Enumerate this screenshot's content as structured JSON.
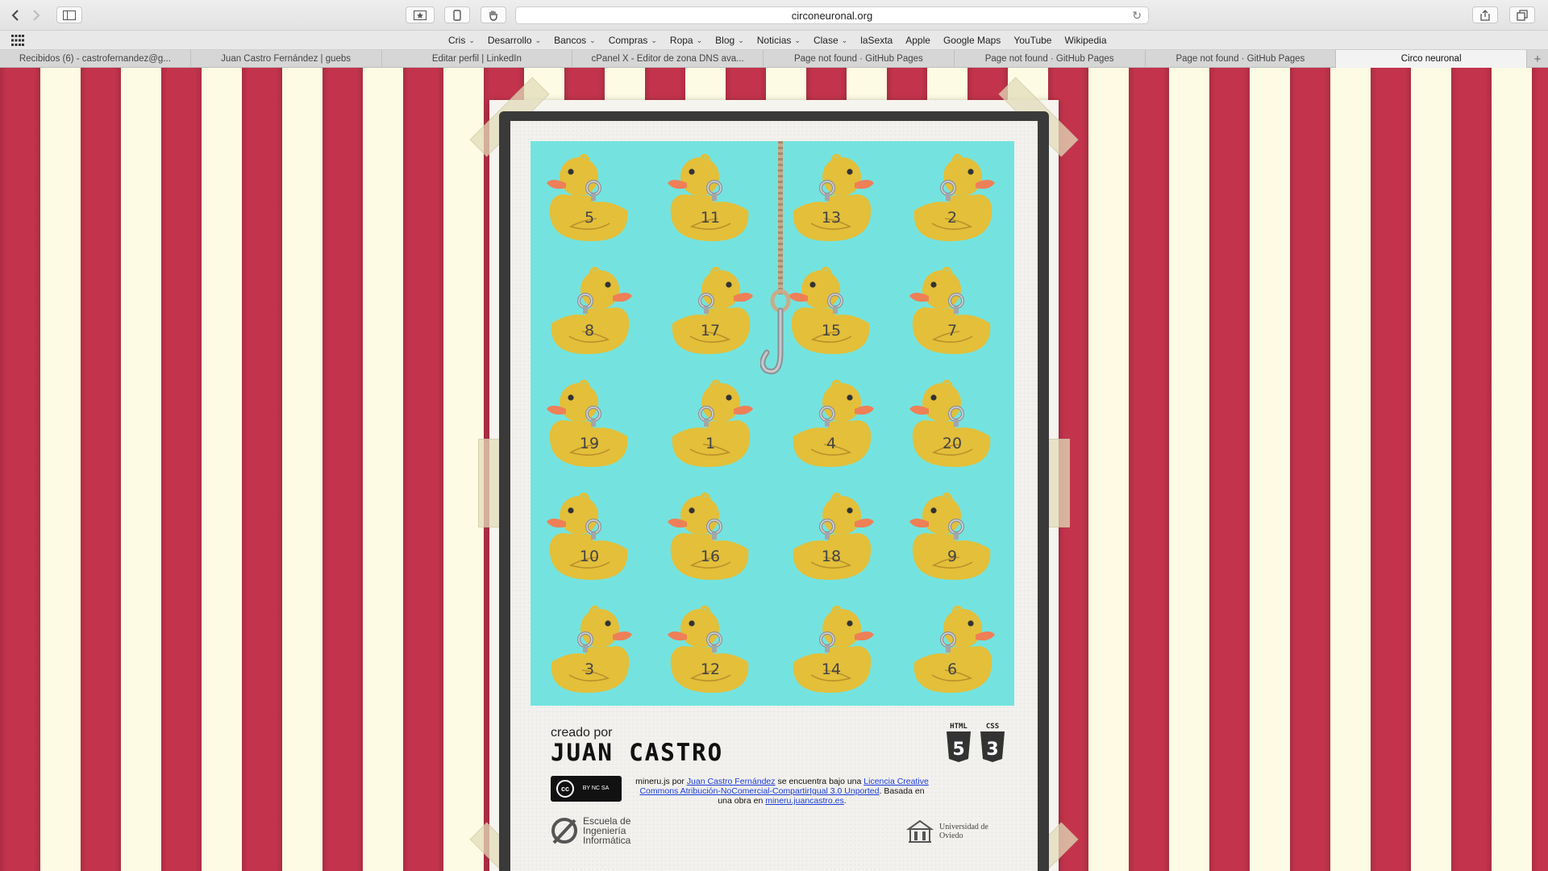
{
  "browser": {
    "url": "circoneuronal.org",
    "favorites": [
      {
        "label": "Cris",
        "menu": true
      },
      {
        "label": "Desarrollo",
        "menu": true
      },
      {
        "label": "Bancos",
        "menu": true
      },
      {
        "label": "Compras",
        "menu": true
      },
      {
        "label": "Ropa",
        "menu": true
      },
      {
        "label": "Blog",
        "menu": true
      },
      {
        "label": "Noticias",
        "menu": true
      },
      {
        "label": "Clase",
        "menu": true
      },
      {
        "label": "laSexta",
        "menu": false
      },
      {
        "label": "Apple",
        "menu": false
      },
      {
        "label": "Google Maps",
        "menu": false
      },
      {
        "label": "YouTube",
        "menu": false
      },
      {
        "label": "Wikipedia",
        "menu": false
      }
    ],
    "tabs": [
      {
        "label": "Recibidos (6) - castrofernandez@g...",
        "active": false
      },
      {
        "label": "Juan Castro Fernández | guebs",
        "active": false
      },
      {
        "label": "Editar perfil | LinkedIn",
        "active": false
      },
      {
        "label": "cPanel X - Editor de zona DNS ava...",
        "active": false
      },
      {
        "label": "Page not found · GitHub Pages",
        "active": false
      },
      {
        "label": "Page not found · GitHub Pages",
        "active": false
      },
      {
        "label": "Page not found · GitHub Pages",
        "active": false
      },
      {
        "label": "Circo neuronal",
        "active": true
      }
    ]
  },
  "game": {
    "ducks": [
      [
        "5",
        "11",
        "13",
        "2"
      ],
      [
        "8",
        "17",
        "15",
        "7"
      ],
      [
        "19",
        "1",
        "4",
        "20"
      ],
      [
        "10",
        "16",
        "18",
        "9"
      ],
      [
        "3",
        "12",
        "14",
        "6"
      ]
    ],
    "duck_facing": [
      [
        "left",
        "left",
        "right",
        "right"
      ],
      [
        "right",
        "right",
        "left",
        "left"
      ],
      [
        "left",
        "right",
        "right",
        "left"
      ],
      [
        "left",
        "left",
        "right",
        "left"
      ],
      [
        "right",
        "left",
        "right",
        "right"
      ]
    ]
  },
  "credits": {
    "created_by": "creado por",
    "author": "JUAN CASTRO",
    "html_label": "HTML",
    "html_num": "5",
    "css_label": "CSS",
    "css_num": "3",
    "cc_text": "BY NC SA",
    "license_prefix": "mineru.js por",
    "license_author": "Juan Castro Fernández",
    "license_middle": "se encuentra bajo una",
    "license_link": "Licencia Creative Commons Atribución-NoComercial-CompartirIgual 3.0 Unported",
    "license_based": ". Basada en una obra en",
    "license_site": "mineru.juancastro.es",
    "license_end": ".",
    "school_line1": "Escuela de",
    "school_line2": "Ingeniería",
    "school_line3": "Informática",
    "uni_line1": "Universidad de",
    "uni_line2": "Oviedo"
  },
  "colors": {
    "stripe_red": "#c3344c",
    "stripe_cream": "#fdfbe3",
    "pond": "#74e3df",
    "duck_body": "#e3bf3a",
    "duck_beak": "#ee7f57"
  }
}
